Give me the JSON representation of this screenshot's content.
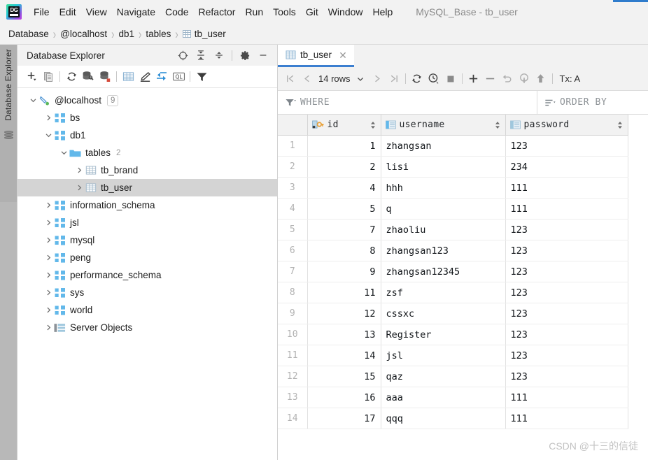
{
  "window": {
    "title": "MySQL_Base - tb_user",
    "logo_icon": "datagrip-logo-icon",
    "logo_text": "DG"
  },
  "menubar": {
    "items": [
      {
        "label": "File",
        "mnemonic": "F"
      },
      {
        "label": "Edit",
        "mnemonic": "E"
      },
      {
        "label": "View",
        "mnemonic": "V"
      },
      {
        "label": "Navigate",
        "mnemonic": "N"
      },
      {
        "label": "Code",
        "mnemonic": "C"
      },
      {
        "label": "Refactor",
        "mnemonic": "R"
      },
      {
        "label": "Run",
        "mnemonic": "u"
      },
      {
        "label": "Tools",
        "mnemonic": "T"
      },
      {
        "label": "Git",
        "mnemonic": "G"
      },
      {
        "label": "Window",
        "mnemonic": "W"
      },
      {
        "label": "Help",
        "mnemonic": "H"
      }
    ]
  },
  "breadcrumb": {
    "separator": "›",
    "items": [
      {
        "label": "Database",
        "icon": ""
      },
      {
        "label": "@localhost",
        "icon": ""
      },
      {
        "label": "db1",
        "icon": ""
      },
      {
        "label": "tables",
        "icon": ""
      },
      {
        "label": "tb_user",
        "icon": "table-icon"
      }
    ]
  },
  "toolstrip": {
    "vertical_tab_label": "Database Explorer",
    "database_icon": "database-stack-icon"
  },
  "explorer": {
    "title": "Database Explorer",
    "header_icons": [
      {
        "name": "locate-target-icon",
        "tooltip": "Select Opened File"
      },
      {
        "name": "expand-all-icon",
        "tooltip": "Expand All"
      },
      {
        "name": "collapse-all-icon",
        "tooltip": "Collapse All"
      },
      {
        "name": "settings-gear-icon",
        "tooltip": "Options"
      },
      {
        "name": "minimize-icon",
        "tooltip": "Hide"
      }
    ],
    "toolbar_icons": [
      {
        "name": "add-icon",
        "tooltip": "New"
      },
      {
        "name": "copy-icon",
        "tooltip": "Duplicate"
      },
      {
        "name": "refresh-icon",
        "tooltip": "Refresh"
      },
      {
        "name": "datasource-tools-icon",
        "tooltip": "Data Source Properties"
      },
      {
        "name": "sync-database-icon",
        "tooltip": "Synchronize"
      },
      {
        "name": "table-grid-icon",
        "tooltip": "Open Data Editor"
      },
      {
        "name": "modify-pencil-icon",
        "tooltip": "Modify Object"
      },
      {
        "name": "jump-to-icon",
        "tooltip": "Jump to Source"
      },
      {
        "name": "query-console-icon",
        "tooltip": "New Query Console",
        "label": "QL"
      },
      {
        "name": "filter-icon",
        "tooltip": "Filter"
      }
    ],
    "tree": [
      {
        "label": "@localhost",
        "icon": "connection-icon",
        "indent": 0,
        "twist": "down",
        "badge": "9",
        "count": "",
        "selected": false
      },
      {
        "label": "bs",
        "icon": "schema-icon",
        "indent": 1,
        "twist": "right",
        "badge": "",
        "count": "",
        "selected": false
      },
      {
        "label": "db1",
        "icon": "schema-icon",
        "indent": 1,
        "twist": "down",
        "badge": "",
        "count": "",
        "selected": false
      },
      {
        "label": "tables",
        "icon": "folder-icon",
        "indent": 2,
        "twist": "down",
        "badge": "",
        "count": "2",
        "selected": false
      },
      {
        "label": "tb_brand",
        "icon": "table-icon",
        "indent": 3,
        "twist": "right",
        "badge": "",
        "count": "",
        "selected": false
      },
      {
        "label": "tb_user",
        "icon": "table-icon",
        "indent": 3,
        "twist": "right",
        "badge": "",
        "count": "",
        "selected": true
      },
      {
        "label": "information_schema",
        "icon": "schema-icon",
        "indent": 1,
        "twist": "right",
        "badge": "",
        "count": "",
        "selected": false
      },
      {
        "label": "jsl",
        "icon": "schema-icon",
        "indent": 1,
        "twist": "right",
        "badge": "",
        "count": "",
        "selected": false
      },
      {
        "label": "mysql",
        "icon": "schema-icon",
        "indent": 1,
        "twist": "right",
        "badge": "",
        "count": "",
        "selected": false
      },
      {
        "label": "peng",
        "icon": "schema-icon",
        "indent": 1,
        "twist": "right",
        "badge": "",
        "count": "",
        "selected": false
      },
      {
        "label": "performance_schema",
        "icon": "schema-icon",
        "indent": 1,
        "twist": "right",
        "badge": "",
        "count": "",
        "selected": false
      },
      {
        "label": "sys",
        "icon": "schema-icon",
        "indent": 1,
        "twist": "right",
        "badge": "",
        "count": "",
        "selected": false
      },
      {
        "label": "world",
        "icon": "schema-icon",
        "indent": 1,
        "twist": "right",
        "badge": "",
        "count": "",
        "selected": false
      },
      {
        "label": "Server Objects",
        "icon": "server-objects-icon",
        "indent": 1,
        "twist": "right",
        "badge": "",
        "count": "",
        "selected": false
      }
    ]
  },
  "editor": {
    "tab": {
      "label": "tb_user",
      "icon": "table-icon",
      "close_icon": "close-icon",
      "active": true
    },
    "toolbar": {
      "first_page_icon": "first-page-icon",
      "prev_page_icon": "prev-page-icon",
      "rows_label": "14 rows",
      "rows_dropdown_icon": "chevron-down-icon",
      "next_page_icon": "next-page-icon",
      "last_page_icon": "last-page-icon",
      "reload_icon": "reload-icon",
      "query_history_icon": "query-history-icon",
      "stop_icon": "stop-icon",
      "add_row_icon": "add-row-icon",
      "delete_row_icon": "delete-row-icon",
      "revert_icon": "revert-icon",
      "rollback_icon": "rollback-icon",
      "commit_icon": "commit-icon",
      "tx_label": "Tx: A"
    },
    "filter": {
      "where_icon": "filter-icon",
      "where_label": "WHERE",
      "order_icon": "sort-icon",
      "order_label": "ORDER BY"
    }
  },
  "grid": {
    "row_number_header": "",
    "columns": [
      {
        "label": "id",
        "icon": "primary-key-icon",
        "sortable": true
      },
      {
        "label": "username",
        "icon": "column-icon",
        "sortable": true
      },
      {
        "label": "password",
        "icon": "column-icon",
        "sortable": true
      }
    ],
    "rows": [
      {
        "n": "1",
        "id": "1",
        "username": "zhangsan",
        "password": "123"
      },
      {
        "n": "2",
        "id": "2",
        "username": "lisi",
        "password": "234"
      },
      {
        "n": "3",
        "id": "4",
        "username": "hhh",
        "password": "111"
      },
      {
        "n": "4",
        "id": "5",
        "username": "q",
        "password": "111"
      },
      {
        "n": "5",
        "id": "7",
        "username": "zhaoliu",
        "password": "123"
      },
      {
        "n": "6",
        "id": "8",
        "username": "zhangsan123",
        "password": "123"
      },
      {
        "n": "7",
        "id": "9",
        "username": "zhangsan12345",
        "password": "123"
      },
      {
        "n": "8",
        "id": "11",
        "username": "zsf",
        "password": "123"
      },
      {
        "n": "9",
        "id": "12",
        "username": "cssxc",
        "password": "123"
      },
      {
        "n": "10",
        "id": "13",
        "username": "Register",
        "password": "123"
      },
      {
        "n": "11",
        "id": "14",
        "username": "jsl",
        "password": "123"
      },
      {
        "n": "12",
        "id": "15",
        "username": "qaz",
        "password": "123"
      },
      {
        "n": "13",
        "id": "16",
        "username": "aaa",
        "password": "111"
      },
      {
        "n": "14",
        "id": "17",
        "username": "qqq",
        "password": "111"
      }
    ]
  },
  "watermark": {
    "text": "CSDN @十三的信徒"
  },
  "colors": {
    "accent_blue": "#3c7fd0",
    "selection_gray": "#d4d4d4",
    "header_bg": "#f2f2f2",
    "schema_icon_blue": "#62b8ea",
    "key_icon_gold": "#e8a33d"
  }
}
